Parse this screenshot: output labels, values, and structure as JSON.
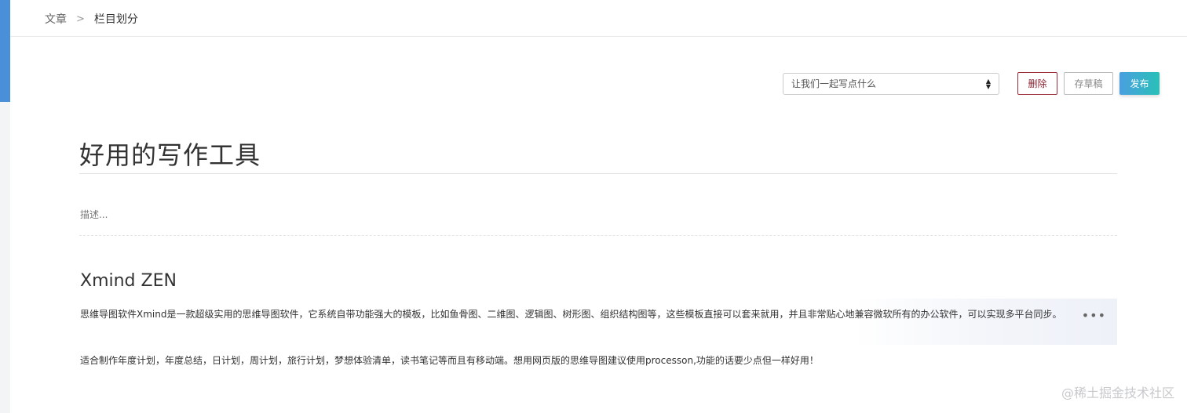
{
  "breadcrumb": {
    "parent": "文章",
    "separator": ">",
    "current": "栏目划分"
  },
  "toolbar": {
    "select_value": "让我们一起写点什么",
    "delete_label": "删除",
    "draft_label": "存草稿",
    "publish_label": "发布"
  },
  "article": {
    "title": "好用的写作工具",
    "description_placeholder": "描述...",
    "heading": "Xmind ZEN",
    "paragraph1": "思维导图软件Xmind是一款超级实用的思维导图软件，它系统自带功能强大的模板，比如鱼骨图、二维图、逻辑图、树形图、组织结构图等，这些模板直接可以套来就用，并且非常贴心地兼容微软所有的办公软件，可以实现多平台同步。",
    "paragraph2": "适合制作年度计划，年度总结，日计划，周计划，旅行计划，梦想体验清单，读书笔记等而且有移动端。想用网页版的思维导图建议使用processon,功能的话要少点但一样好用！"
  },
  "watermark": "@稀土掘金技术社区",
  "colors": {
    "accent": "#4a90d9",
    "delete": "#8b2332",
    "publish_start": "#4a9fe0",
    "publish_end": "#29c0b8"
  }
}
